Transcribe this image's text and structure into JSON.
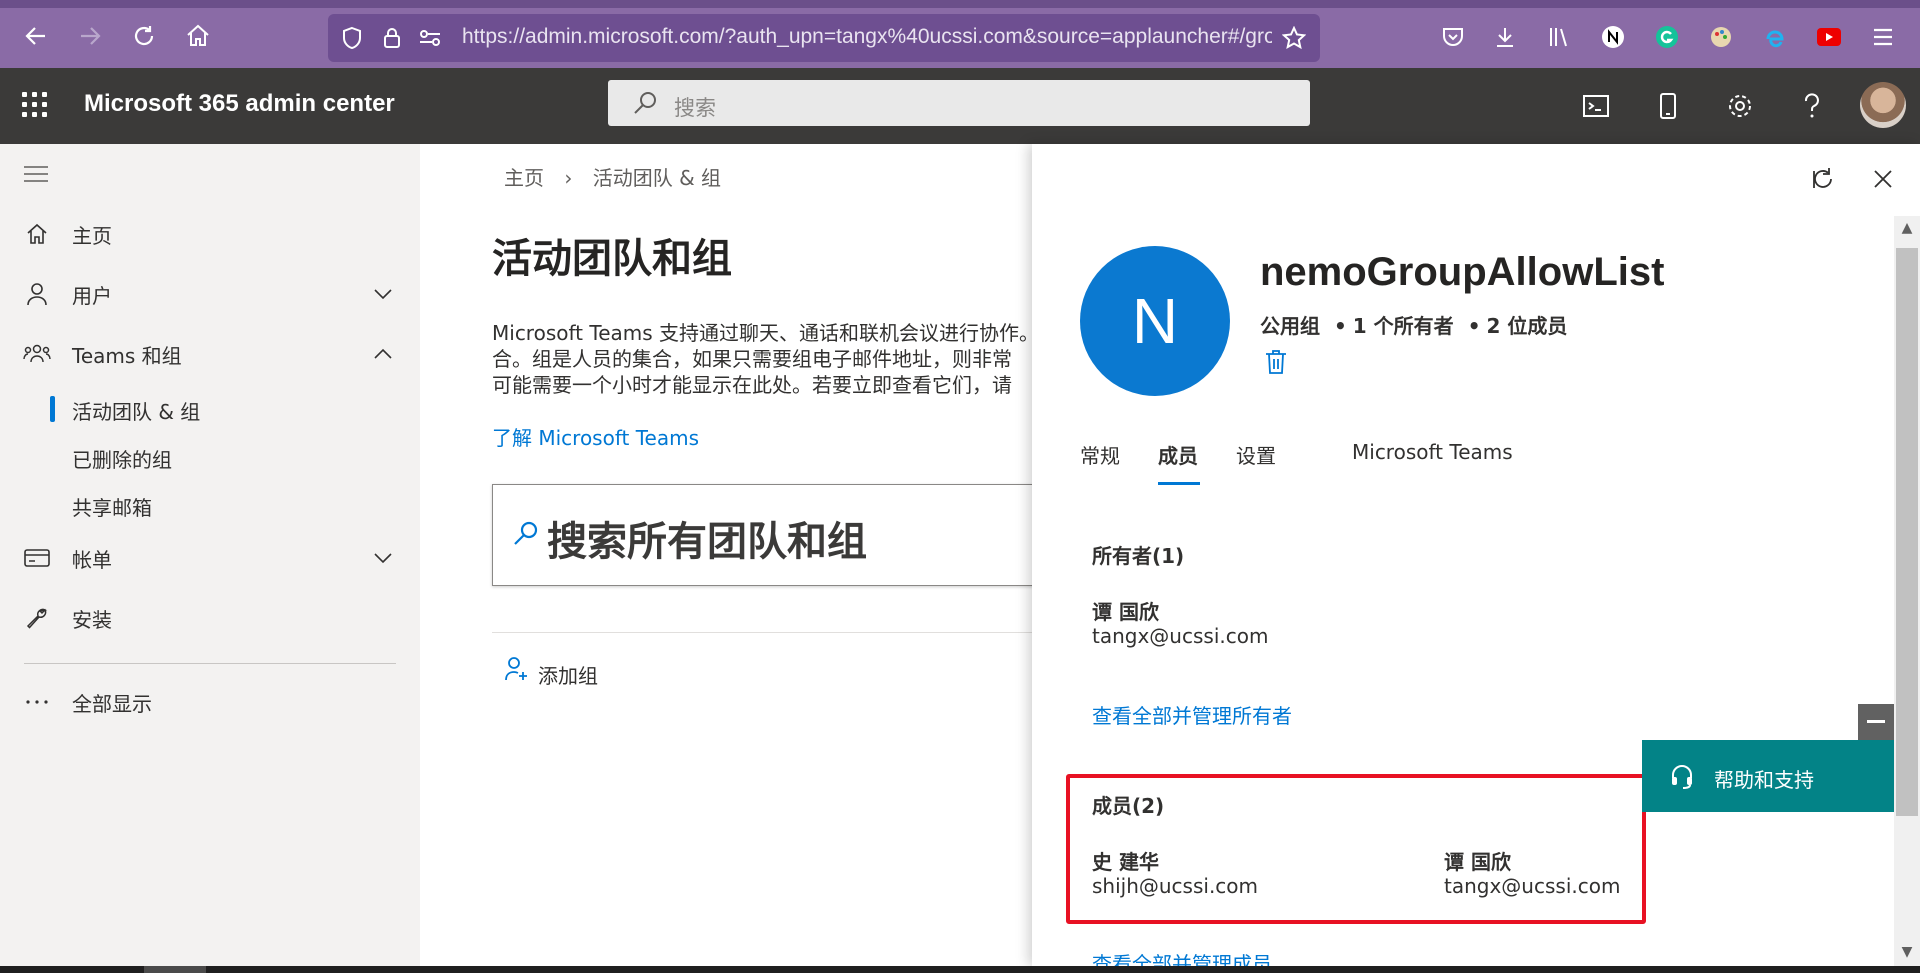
{
  "browser": {
    "url": "https://admin.microsoft.com/?auth_upn=tangx%40ucssi.com&source=applauncher#/gro"
  },
  "header": {
    "app_title": "Microsoft 365 admin center",
    "search_placeholder": "搜索"
  },
  "sidebar": {
    "items": [
      {
        "label": "主页",
        "icon": "home-icon"
      },
      {
        "label": "用户",
        "icon": "person-icon"
      },
      {
        "label": "Teams 和组",
        "icon": "people-icon"
      },
      {
        "label": "帐单",
        "icon": "card-icon"
      },
      {
        "label": "安装",
        "icon": "wrench-icon"
      },
      {
        "label": "全部显示",
        "icon": "more-icon"
      }
    ],
    "sub_items": [
      "活动团队 & 组",
      "已删除的组",
      "共享邮箱"
    ]
  },
  "main": {
    "breadcrumb": [
      "主页",
      "活动团队 & 组"
    ],
    "title": "活动团队和组",
    "description_lines": [
      "Microsoft Teams 支持通过聊天、通话和联机会议进行协作。",
      "合。组是人员的集合，如果只需要组电子邮件地址，则非常",
      "可能需要一个小时才能显示在此处。若要立即查看它们，请"
    ],
    "learn_link": "了解 Microsoft Teams",
    "search_placeholder": "搜索所有团队和组",
    "add_group_label": "添加组"
  },
  "panel": {
    "avatar_letter": "N",
    "group_name": "nemoGroupAllowList",
    "group_type": "公用组",
    "owners_count_text": "1 个所有者",
    "members_count_text": "2 位成员",
    "tabs": [
      "常规",
      "成员",
      "设置",
      "Microsoft Teams"
    ],
    "active_tab": "成员",
    "owners_title": "所有者(1)",
    "owners": [
      {
        "name": "谭 国欣",
        "email": "tangx@ucssi.com"
      }
    ],
    "owners_link": "查看全部并管理所有者",
    "members_title": "成员(2)",
    "members": [
      {
        "name": "史 建华",
        "email": "shijh@ucssi.com"
      },
      {
        "name": "谭 国欣",
        "email": "tangx@ucssi.com"
      }
    ],
    "members_link": "查看全部并管理成员"
  },
  "help": {
    "label": "帮助和支持"
  },
  "colors": {
    "browser_bar": "#8a6ba6",
    "admin_header": "#3b3a39",
    "accent": "#0078d4",
    "group_avatar": "#0b79d0",
    "help_button": "#038387",
    "highlight": "#e81123"
  }
}
